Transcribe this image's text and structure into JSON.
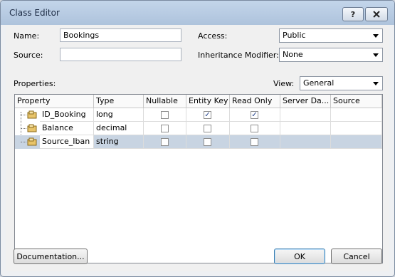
{
  "window": {
    "title": "Class Editor",
    "help_label": "?",
    "close_icon": "close-icon"
  },
  "form": {
    "name_label": "Name:",
    "name_value": "Bookings",
    "source_label": "Source:",
    "source_value": "",
    "access_label": "Access:",
    "access_value": "Public",
    "inheritance_label": "Inheritance Modifier:",
    "inheritance_value": "None",
    "properties_label": "Properties:",
    "view_label": "View:",
    "view_value": "General"
  },
  "grid": {
    "columns": [
      "Property",
      "Type",
      "Nullable",
      "Entity Key",
      "Read Only",
      "Server Da...",
      "Source"
    ],
    "rows": [
      {
        "property": "ID_Booking",
        "type": "long",
        "nullable": false,
        "entity_key": true,
        "read_only": true,
        "server_data": "",
        "source": ""
      },
      {
        "property": "Balance",
        "type": "decimal",
        "nullable": false,
        "entity_key": false,
        "read_only": false,
        "server_data": "",
        "source": ""
      },
      {
        "property": "Source_Iban",
        "type": "string",
        "nullable": false,
        "entity_key": false,
        "read_only": false,
        "server_data": "",
        "source": ""
      }
    ],
    "selected_row": 2
  },
  "buttons": {
    "documentation": "Documentation...",
    "ok": "OK",
    "cancel": "Cancel"
  },
  "colors": {
    "titlebar": "#aec3dc",
    "selection": "#c8d4e2",
    "background": "#f0f0f0"
  }
}
